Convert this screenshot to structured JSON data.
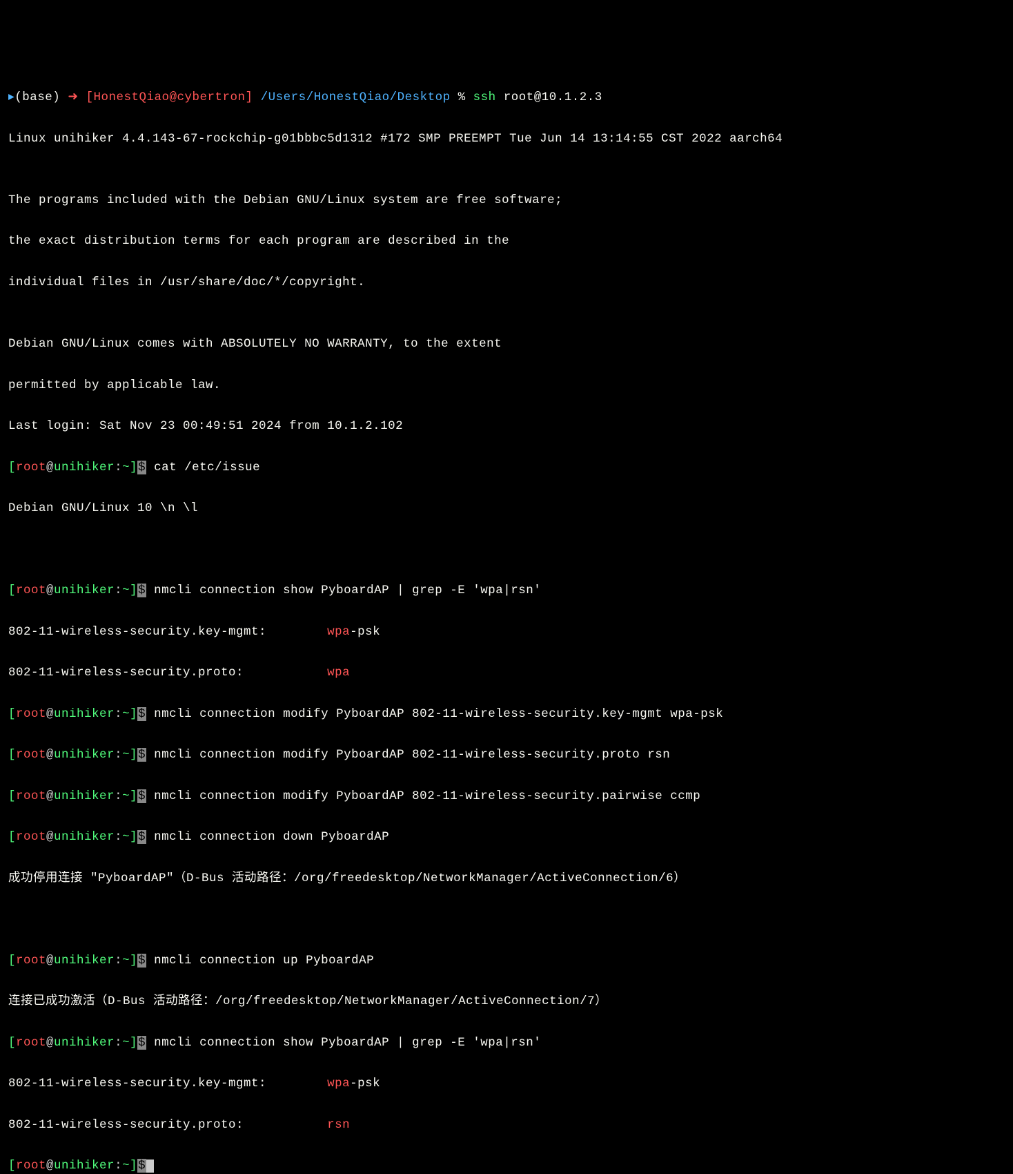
{
  "line1": {
    "caret": "▸",
    "base": "(base)",
    "arrow": "➜",
    "user_host": "[HonestQiao@cybertron]",
    "path": "/Users/HonestQiao/Desktop",
    "percent": "%",
    "cmd_ssh": "ssh",
    "cmd_target": "root@10.1.2.3"
  },
  "motd": {
    "l1": "Linux unihiker 4.4.143-67-rockchip-g01bbbc5d1312 #172 SMP PREEMPT Tue Jun 14 13:14:55 CST 2022 aarch64",
    "l2": "",
    "l3": "The programs included with the Debian GNU/Linux system are free software;",
    "l4": "the exact distribution terms for each program are described in the",
    "l5": "individual files in /usr/share/doc/*/copyright.",
    "l6": "",
    "l7": "Debian GNU/Linux comes with ABSOLUTELY NO WARRANTY, to the extent",
    "l8": "permitted by applicable law.",
    "l9": "Last login: Sat Nov 23 00:49:51 2024 from 10.1.2.102"
  },
  "prompt": {
    "open": "[",
    "root": "root",
    "at": "@",
    "host": "unihiker",
    "colon": ":",
    "tilde": "~",
    "close": "]",
    "dollar": "$"
  },
  "cmd1": " cat /etc/issue",
  "out1": "Debian GNU/Linux 10 \\n \\l",
  "cmd2": " nmcli connection show PyboardAP | grep -E 'wpa|rsn'",
  "out2a_prefix": "802-11-wireless-security.key-mgmt:        ",
  "out2a_hl": "wpa",
  "out2a_suffix": "-psk",
  "out2b_prefix": "802-11-wireless-security.proto:           ",
  "out2b_hl": "wpa",
  "cmd3": " nmcli connection modify PyboardAP 802-11-wireless-security.key-mgmt wpa-psk",
  "cmd4": " nmcli connection modify PyboardAP 802-11-wireless-security.proto rsn",
  "cmd5": " nmcli connection modify PyboardAP 802-11-wireless-security.pairwise ccmp",
  "cmd6": " nmcli connection down PyboardAP",
  "out6": "成功停用连接 \"PyboardAP\"（D-Bus 活动路径：/org/freedesktop/NetworkManager/ActiveConnection/6）",
  "cmd7": " nmcli connection up PyboardAP",
  "out7": "连接已成功激活（D-Bus 活动路径：/org/freedesktop/NetworkManager/ActiveConnection/7）",
  "cmd8": " nmcli connection show PyboardAP | grep -E 'wpa|rsn'",
  "out8a_prefix": "802-11-wireless-security.key-mgmt:        ",
  "out8a_hl": "wpa",
  "out8a_suffix": "-psk",
  "out8b_prefix": "802-11-wireless-security.proto:           ",
  "out8b_hl": "rsn"
}
